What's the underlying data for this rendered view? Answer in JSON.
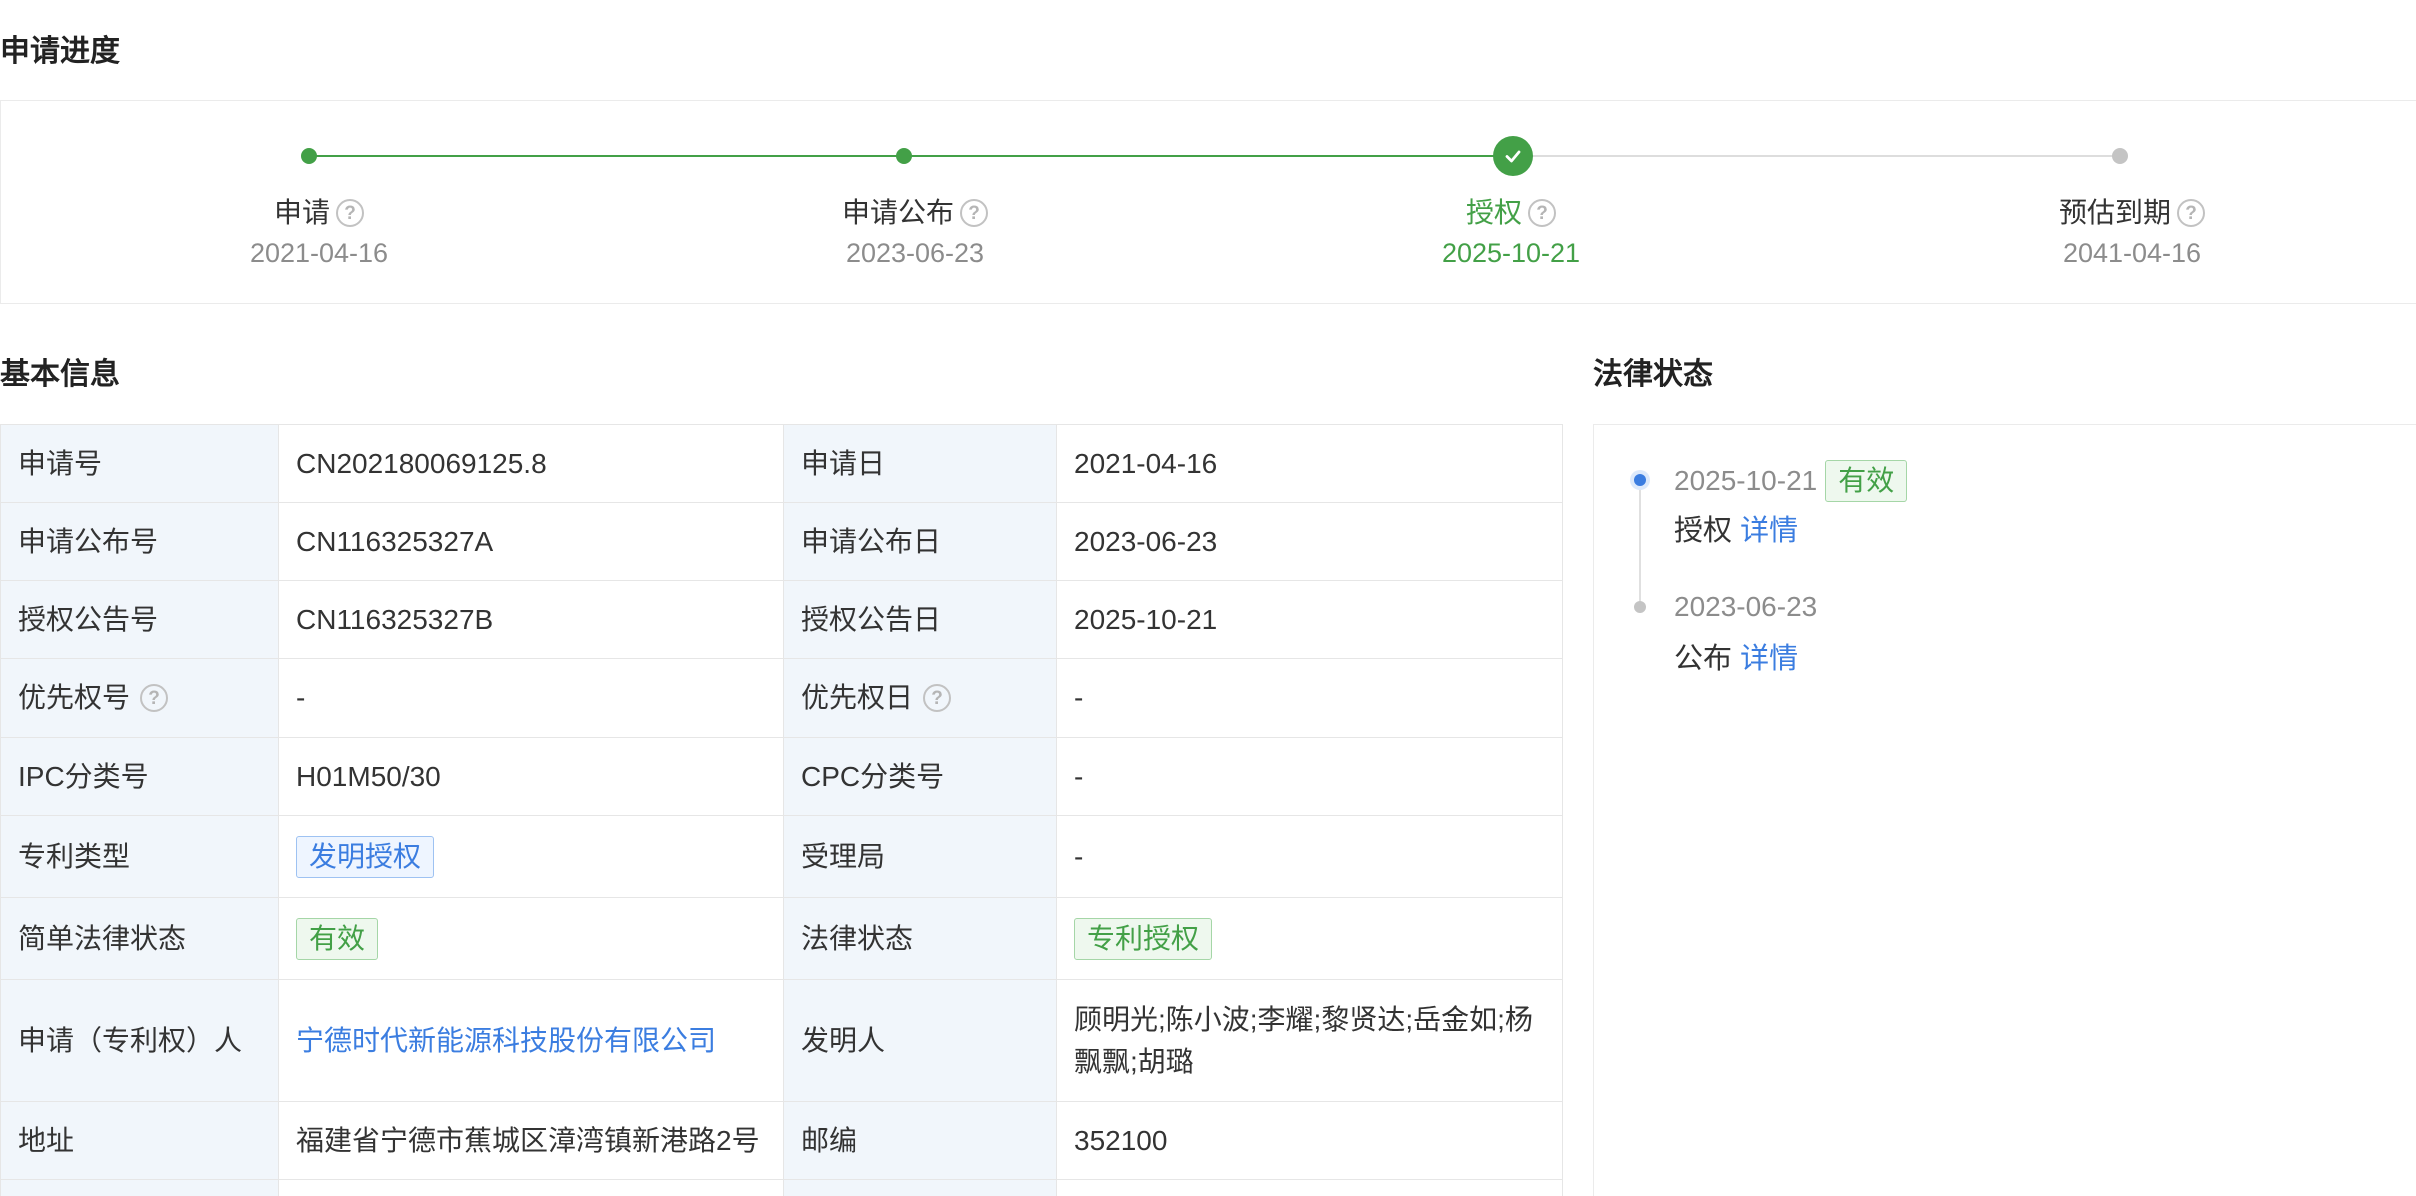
{
  "progress": {
    "title": "申请进度",
    "steps": [
      {
        "label": "申请",
        "date": "2021-04-16",
        "status": "done"
      },
      {
        "label": "申请公布",
        "date": "2023-06-23",
        "status": "done"
      },
      {
        "label": "授权",
        "date": "2025-10-21",
        "status": "current"
      },
      {
        "label": "预估到期",
        "date": "2041-04-16",
        "status": "pending"
      }
    ],
    "colors": {
      "done": "#43a047",
      "pending": "#c4c4c4"
    }
  },
  "basic_info": {
    "title": "基本信息",
    "rows": [
      {
        "l1": "申请号",
        "v1": "CN202180069125.8",
        "l2": "申请日",
        "v2": "2021-04-16"
      },
      {
        "l1": "申请公布号",
        "v1": "CN116325327A",
        "l2": "申请公布日",
        "v2": "2023-06-23"
      },
      {
        "l1": "授权公告号",
        "v1": "CN116325327B",
        "l2": "授权公告日",
        "v2": "2025-10-21"
      },
      {
        "l1": "优先权号",
        "v1": "-",
        "l2": "优先权日",
        "v2": "-"
      },
      {
        "l1": "IPC分类号",
        "v1": "H01M50/30",
        "l2": "CPC分类号",
        "v2": "-"
      },
      {
        "l1": "专利类型",
        "v1": "发明授权",
        "l2": "受理局",
        "v2": "-"
      },
      {
        "l1": "简单法律状态",
        "v1": "有效",
        "l2": "法律状态",
        "v2": "专利授权"
      },
      {
        "l1": "申请（专利权）人",
        "v1": "宁德时代新能源科技股份有限公司",
        "l2": "发明人",
        "v2": "顾明光;陈小波;李耀;黎贤达;岳金如;杨飘飘;胡璐"
      },
      {
        "l1": "地址",
        "v1": "福建省宁德市蕉城区漳湾镇新港路2号",
        "l2": "邮编",
        "v2": "352100"
      }
    ]
  },
  "legal_status": {
    "title": "法律状态",
    "events": [
      {
        "date": "2025-10-21",
        "badge": "有效",
        "desc": "授权",
        "link": "详情"
      },
      {
        "date": "2023-06-23",
        "desc": "公布",
        "link": "详情"
      }
    ]
  },
  "help_glyph": "?"
}
